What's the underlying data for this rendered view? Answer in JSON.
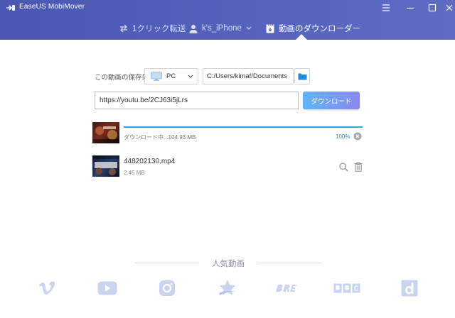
{
  "app": {
    "title": "EaseUS MobiMover"
  },
  "window_controls": {
    "menu_icon": "hamburger-icon",
    "minimize_icon": "minimize-icon",
    "maximize_icon": "maximize-icon",
    "close_icon": "close-icon"
  },
  "nav": {
    "transfer_label": "1クリック転送",
    "device_label": "k's_iPhone",
    "download_label": "動画のダウンローダー",
    "active": "download"
  },
  "save": {
    "label": "この動画の保存先",
    "device": "PC",
    "path": "C:/Users/kimaf/Documents"
  },
  "url": {
    "value": "https://youtu.be/2CJ63i5jLrs"
  },
  "download_button": "ダウンロード",
  "downloads": [
    {
      "status": "ダウンロード中...104.93 MB",
      "progress_percent": 100,
      "percent_label": "100%"
    },
    {
      "name": "448202130.mp4",
      "size": "2.45 MB"
    }
  ],
  "popular": {
    "title": "人気動画",
    "sites": [
      "vimeo-icon",
      "youtube-icon",
      "instagram-icon",
      "dailystar-icon",
      "break-icon",
      "bbc-icon",
      "dailymotion-icon"
    ]
  },
  "colors": {
    "header": "#4f5cba",
    "accent": "#2fa7e2",
    "button_start": "#5fb6f6",
    "button_end": "#8a87f0",
    "site_icons": "#c9d5f0"
  }
}
